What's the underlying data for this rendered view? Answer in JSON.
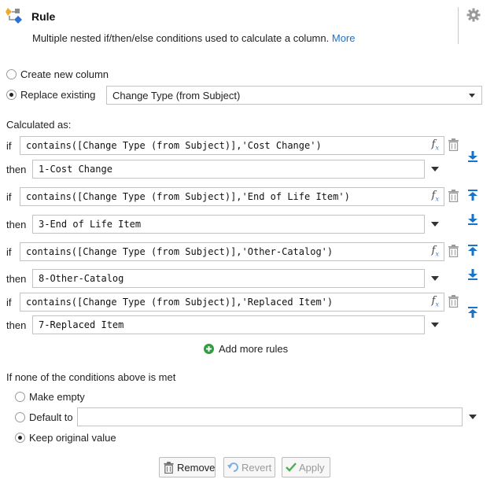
{
  "header": {
    "title": "Rule",
    "description": "Multiple nested if/then/else conditions used to calculate a column.",
    "more_link": "More"
  },
  "target": {
    "create_label": "Create new column",
    "replace_label": "Replace existing",
    "replace_selected": "Change Type (from Subject)",
    "selected_option": "replace"
  },
  "calculated_as_label": "Calculated as:",
  "keywords": {
    "if": "if",
    "then": "then"
  },
  "rules": [
    {
      "if": "contains([Change Type (from Subject)],'Cost Change')",
      "then": "1-Cost Change"
    },
    {
      "if": "contains([Change Type (from Subject)],'End of Life Item')",
      "then": "3-End of Life Item"
    },
    {
      "if": "contains([Change Type (from Subject)],'Other-Catalog')",
      "then": "8-Other-Catalog"
    },
    {
      "if": "contains([Change Type (from Subject)],'Replaced Item')",
      "then": "7-Replaced Item"
    }
  ],
  "add_rules_label": "Add more rules",
  "fallback": {
    "heading": "If none of the conditions above is met",
    "make_empty_label": "Make empty",
    "default_to_label": "Default to",
    "default_to_value": "",
    "keep_original_label": "Keep original value",
    "selected_option": "keep_original"
  },
  "buttons": {
    "remove": "Remove",
    "revert": "Revert",
    "apply": "Apply"
  },
  "colors": {
    "accent_blue": "#1a73c8",
    "add_green": "#2e9e3e",
    "apply_green": "#4caf50"
  },
  "icons": {
    "rule_icon": "rule-flow-icon",
    "settings_icon": "gear-icon",
    "formula_icon": "fx-icon",
    "delete_icon": "trash-icon",
    "move_down_icon": "move-down-icon",
    "move_top_icon": "move-to-top-icon"
  }
}
